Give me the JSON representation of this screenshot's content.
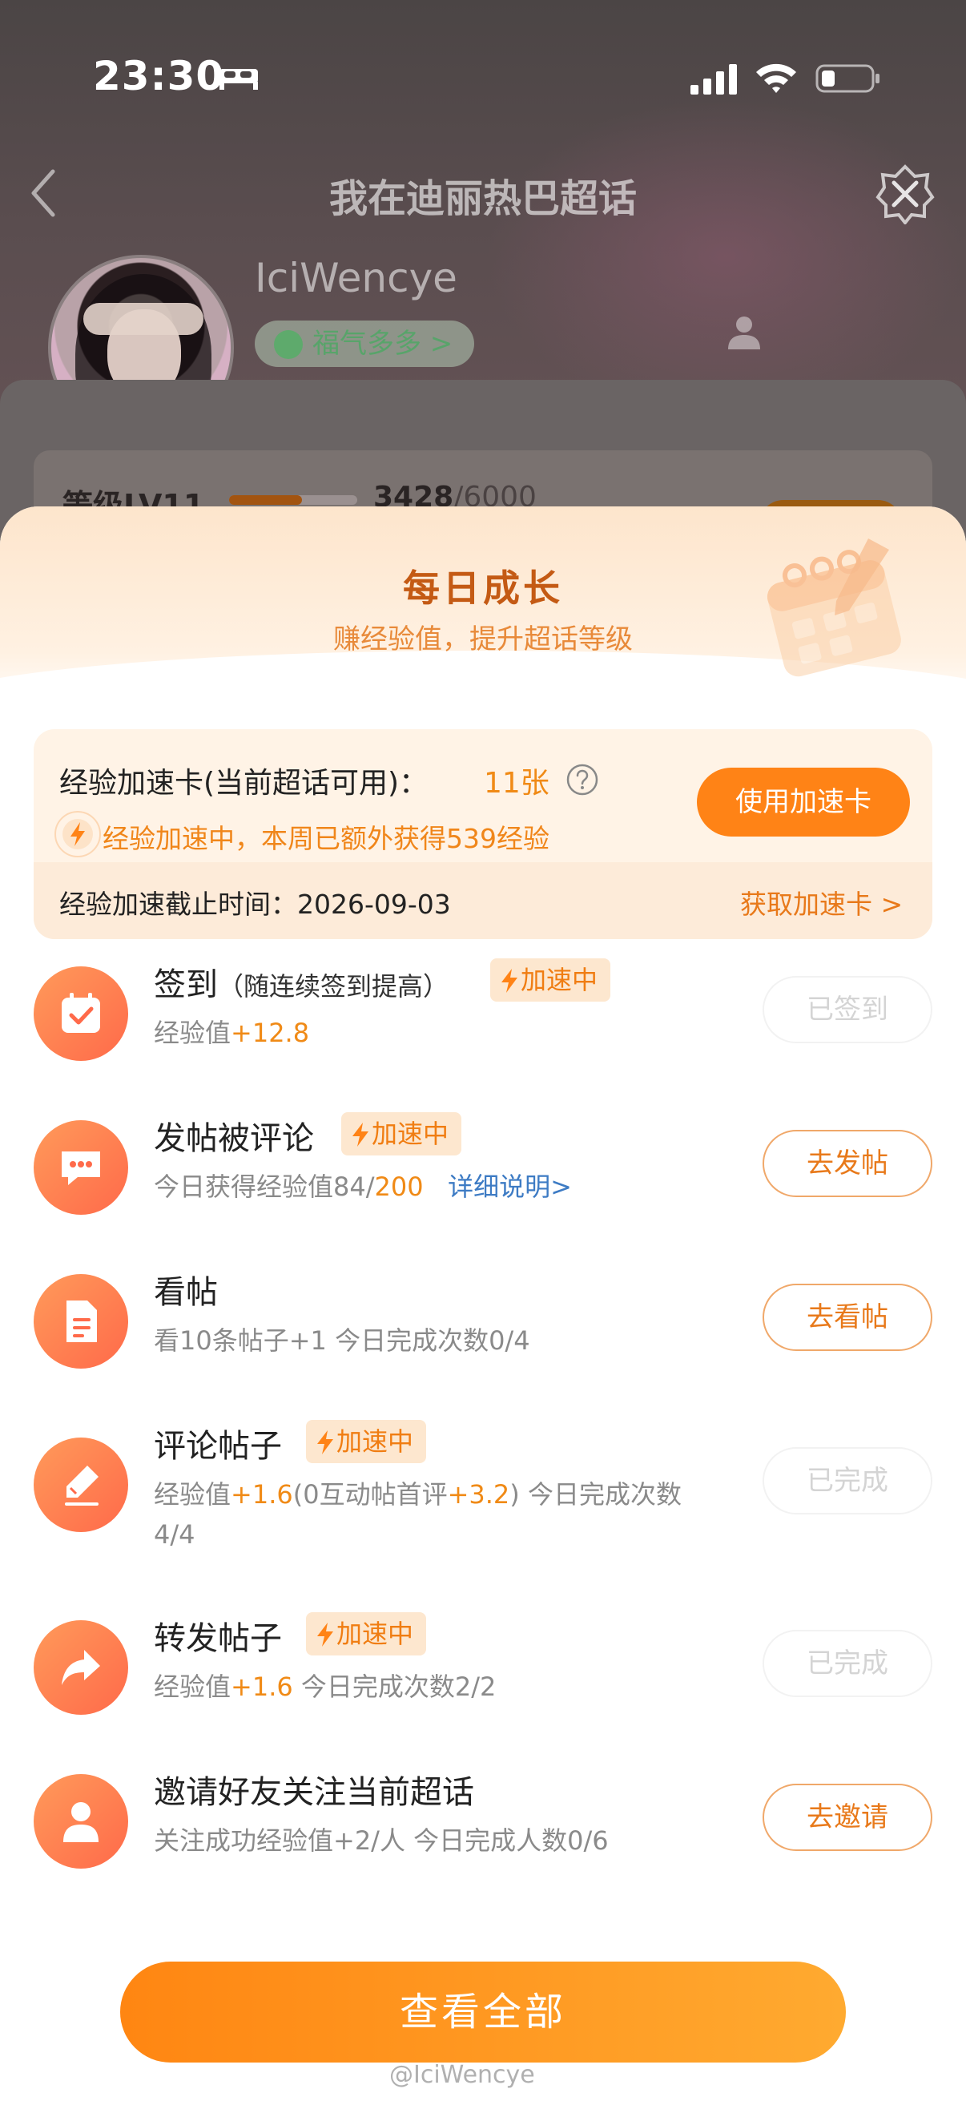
{
  "status_bar": {
    "time": "23:30"
  },
  "nav": {
    "title": "我在迪丽热巴超话"
  },
  "profile": {
    "username": "IciWencye",
    "fortune_label": "福气多多 >"
  },
  "level": {
    "label": "等级LV11",
    "current": "3428",
    "total": "/6000",
    "progress": 0.571
  },
  "sheet": {
    "title": "每日成长",
    "subtitle": "赚经验值，提升超话等级",
    "boost_card": {
      "label": "经验加速卡(当前超话可用)：",
      "count": "11张",
      "status": "经验加速中，本周已额外获得539经验",
      "use_button": "使用加速卡",
      "deadline": "经验加速截止时间：2026-09-03",
      "get_link": "获取加速卡 >"
    },
    "boost_chip": "加速中",
    "tasks": [
      {
        "title": "签到",
        "note": "（随连续签到提高）",
        "desc_prefix": "经验值",
        "desc_hl": "+12.8",
        "button": "已签到"
      },
      {
        "title": "发帖被评论",
        "desc_prefix": "今日获得经验值84/",
        "desc_hl": "200",
        "desc_link": "详细说明>",
        "button": "去发帖"
      },
      {
        "title": "看帖",
        "desc": "看10条帖子+1   今日完成次数0/4",
        "button": "去看帖"
      },
      {
        "title": "评论帖子",
        "desc_a": "经验值",
        "desc_hl1": "+1.6",
        "desc_b": "(0互动帖首评",
        "desc_hl2": "+3.2",
        "desc_c": ")   今日完成次数",
        "desc_line2": "4/4",
        "button": "已完成"
      },
      {
        "title": "转发帖子",
        "desc_a": "经验值",
        "desc_hl": "+1.6",
        "desc_b": "   今日完成次数2/2",
        "button": "已完成"
      },
      {
        "title": "邀请好友关注当前超话",
        "desc": "关注成功经验值+2/人   今日完成人数0/6",
        "button": "去邀请"
      }
    ],
    "view_all_button": "查看全部"
  },
  "watermark": "@IciWencye",
  "colors": {
    "accent": "#ff8316",
    "title": "#c45a14",
    "link": "#3d7bc4"
  }
}
